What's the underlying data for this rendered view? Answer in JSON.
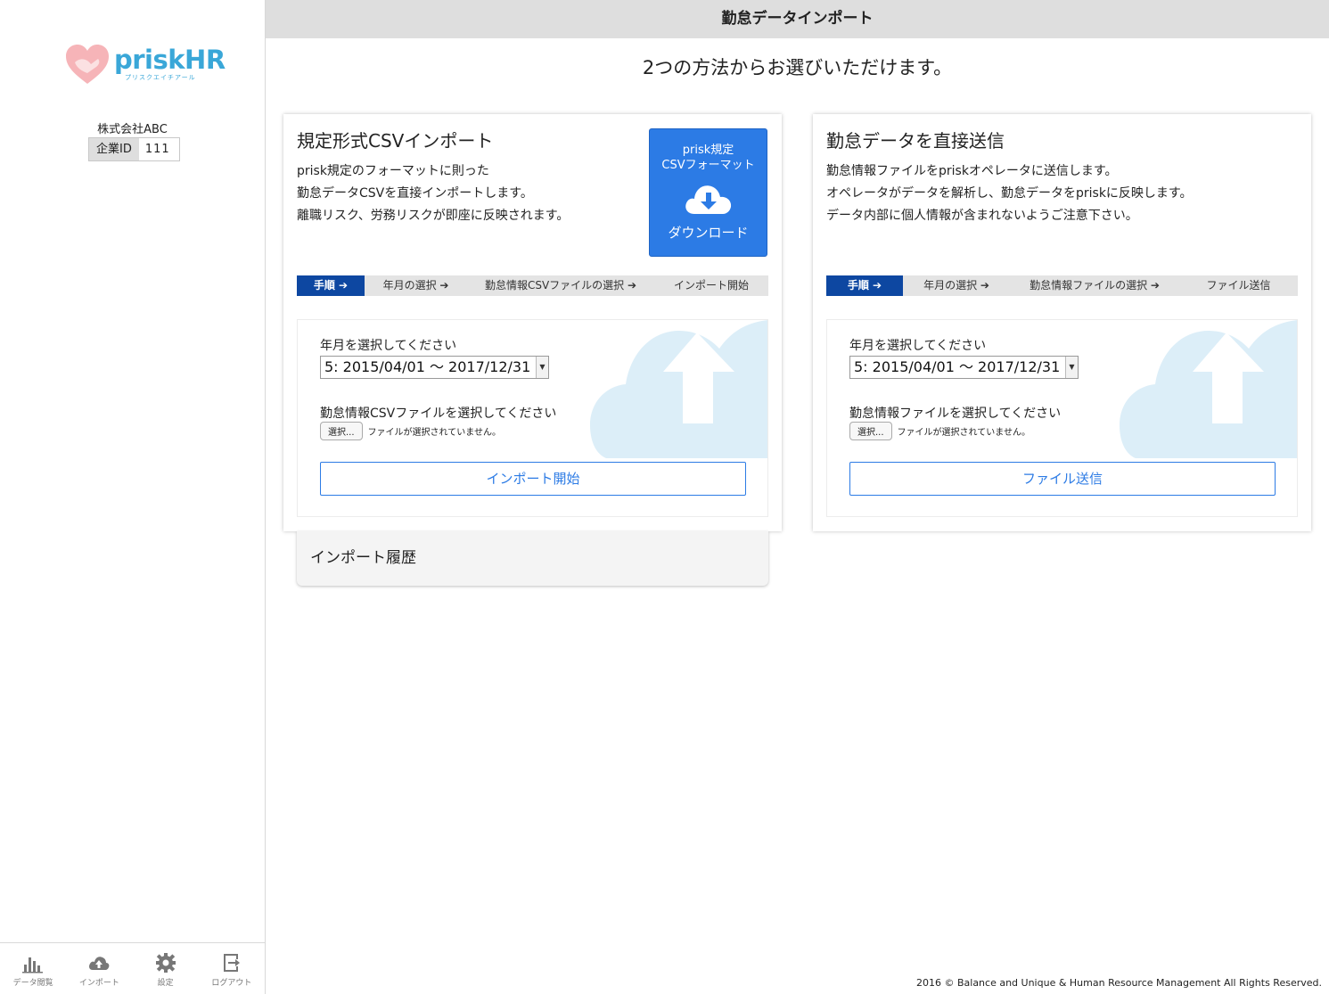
{
  "sidebar": {
    "logo_text": "priskHR",
    "logo_sub": "プリスクエイチアール",
    "company_name": "株式会社ABC",
    "company_id_label": "企業ID",
    "company_id_value": "111",
    "nav": [
      {
        "label": "データ閲覧",
        "icon": "bar-chart-icon"
      },
      {
        "label": "インポート",
        "icon": "cloud-upload-icon"
      },
      {
        "label": "設定",
        "icon": "gear-icon"
      },
      {
        "label": "ログアウト",
        "icon": "logout-icon"
      }
    ]
  },
  "header": {
    "title": "勤怠データインポート",
    "subtitle": "2つの方法からお選びいただけます。"
  },
  "csv_card": {
    "title": "規定形式CSVインポート",
    "desc": [
      "prisk規定のフォーマットに則った",
      "勤怠データCSVを直接インポートします。",
      "離職リスク、労務リスクが即座に反映されます。"
    ],
    "download_line1": "prisk規定",
    "download_line2": "CSVフォーマット",
    "download_label": "ダウンロード",
    "steps": [
      "手順 ➔",
      "年月の選択 ➔",
      "勤怠情報CSVファイルの選択 ➔",
      "インポート開始"
    ],
    "period_label": "年月を選択してください",
    "period_value": "5: 2015/04/01 〜 2017/12/31",
    "file_label": "勤怠情報CSVファイルを選択してください",
    "file_button": "選択...",
    "file_status": "ファイルが選択されていません。",
    "action": "インポート開始"
  },
  "direct_card": {
    "title": "勤怠データを直接送信",
    "desc": [
      "勤怠情報ファイルをpriskオペレータに送信します。",
      "オペレータがデータを解析し、勤怠データをpriskに反映します。",
      "データ内部に個人情報が含まれないようご注意下さい。"
    ],
    "steps": [
      "手順 ➔",
      "年月の選択 ➔",
      "勤怠情報ファイルの選択 ➔",
      "ファイル送信"
    ],
    "period_label": "年月を選択してください",
    "period_value": "5: 2015/04/01 〜 2017/12/31",
    "file_label": "勤怠情報ファイルを選択してください",
    "file_button": "選択...",
    "file_status": "ファイルが選択されていません。",
    "action": "ファイル送信"
  },
  "history": {
    "title": "インポート履歴"
  },
  "footer": "2016 © Balance and Unique & Human Resource Management All Rights Reserved.",
  "colors": {
    "accent": "#2c7be5",
    "step_active": "#0d47a1",
    "logo": "#3aa7d8"
  }
}
